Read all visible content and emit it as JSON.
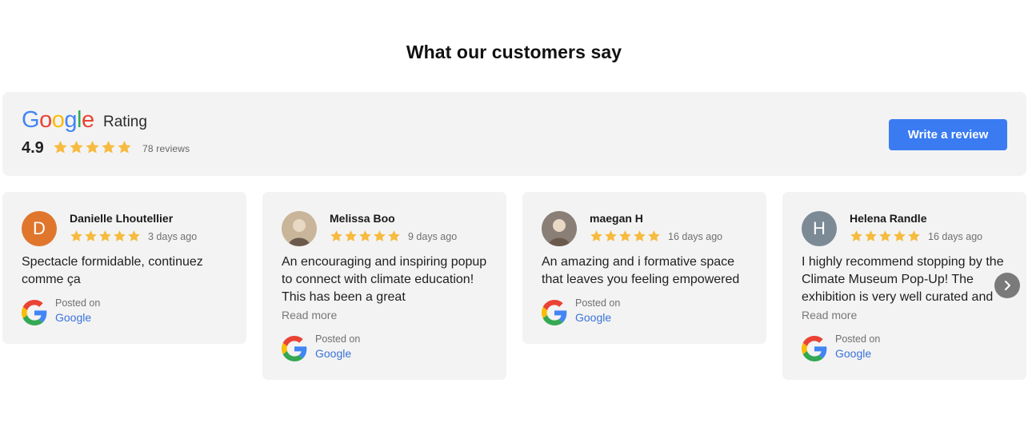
{
  "section": {
    "title": "What our customers say"
  },
  "rating": {
    "brand": "Google",
    "label": "Rating",
    "score": "4.9",
    "stars": 5,
    "count": "78",
    "count_suffix": "reviews",
    "write_review_label": "Write a review"
  },
  "colors": {
    "accent": "#3a7bf2",
    "star": "#f6bb3f",
    "card_bg": "#f3f3f3",
    "link": "#3a73d9"
  },
  "reviews": [
    {
      "name": "Danielle Lhoutellier",
      "avatar_letter": "D",
      "avatar_color": "#e0762c",
      "stars": 5,
      "date": "3 days ago",
      "text": "Spectacle formidable, continuez comme ça",
      "read_more": "",
      "posted_on": "Posted on",
      "source": "Google"
    },
    {
      "name": "Melissa Boo",
      "avatar_letter": "",
      "avatar_color": "#c9b59a",
      "stars": 5,
      "date": "9 days ago",
      "text": "An encouraging and inspiring popup to connect with climate education! This has been a great",
      "read_more": "Read more",
      "posted_on": "Posted on",
      "source": "Google"
    },
    {
      "name": "maegan H",
      "avatar_letter": "",
      "avatar_color": "#8a7f76",
      "stars": 5,
      "date": "16 days ago",
      "text": "An amazing and i formative space that leaves you feeling empowered",
      "read_more": "",
      "posted_on": "Posted on",
      "source": "Google"
    },
    {
      "name": "Helena Randle",
      "avatar_letter": "H",
      "avatar_color": "#7c8a96",
      "stars": 5,
      "date": "16 days ago",
      "text": "I highly recommend stopping by the Climate Museum Pop-Up! The exhibition is very well curated and",
      "read_more": "Read more",
      "posted_on": "Posted on",
      "source": "Google"
    }
  ],
  "carousel": {
    "next_icon": "chevron-right-icon"
  }
}
